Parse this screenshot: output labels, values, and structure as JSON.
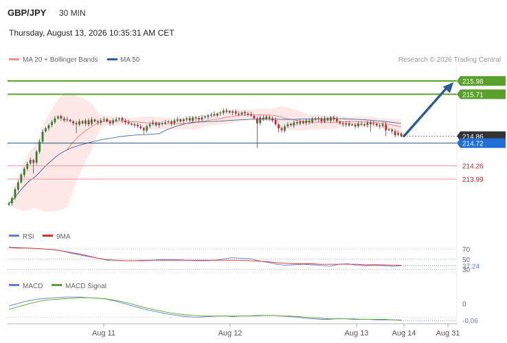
{
  "header": {
    "symbol": "GBP/JPY",
    "timeframe": "30 MIN",
    "datetime": "Thursday, August 13, 2026 10:35:31 AM CET"
  },
  "legend": {
    "ma20": "MA 20 + Bollinger Bands",
    "ma50": "MA 50",
    "credit": "Research © 2026 Trading Central"
  },
  "colors": {
    "up_candle": "#2e7d32",
    "down_candle": "#c62828",
    "ma20": "#e57373",
    "ma50": "#2f5a8f",
    "bollinger_fill": "#fde3e3",
    "resistance": "#5aa02c",
    "support": "#f4a6a6",
    "current_price_line": "#1e4f7a",
    "last_price_badge": "#333333",
    "pivot_badge": "#1f6fd6",
    "forecast_arrow": "#2f5a8f",
    "rsi": "#5b7fd6",
    "rsi_ma": "#d32f2f",
    "macd": "#5b7fd6",
    "macd_signal": "#5aa02c"
  },
  "chart_data": [
    {
      "type": "candlestick",
      "title": "",
      "x": [
        "Aug 11",
        "Aug 12",
        "Aug 13",
        "Aug 14",
        "Aug 31"
      ],
      "ylim": [
        213.1,
        216.3
      ],
      "levels": [
        {
          "value": 215.98,
          "label": "215.98",
          "kind": "resistance"
        },
        {
          "value": 215.71,
          "label": "215.71",
          "kind": "resistance"
        },
        {
          "value": 214.86,
          "label": "214.86",
          "kind": "last"
        },
        {
          "value": 214.72,
          "label": "214.72",
          "kind": "pivot"
        },
        {
          "value": 214.26,
          "label": "214.26",
          "kind": "support"
        },
        {
          "value": 213.99,
          "label": "213.99",
          "kind": "support"
        }
      ],
      "forecast": {
        "from": 214.86,
        "to": 215.98
      },
      "close_path": [
        213.5,
        213.6,
        213.78,
        213.92,
        214.08,
        214.2,
        214.3,
        214.38,
        214.32,
        214.55,
        214.75,
        214.95,
        215.02,
        215.08,
        215.15,
        215.22,
        215.26,
        215.22,
        215.18,
        215.2,
        215.16,
        215.12,
        215.1,
        215.16,
        215.12,
        215.18,
        215.1,
        215.2,
        215.16,
        215.14,
        215.18,
        215.2,
        215.16,
        215.12,
        215.18,
        215.2,
        215.22,
        215.18,
        215.14,
        215.12,
        215.1,
        215.08,
        215.06,
        215.02,
        214.98,
        215.06,
        215.1,
        215.14,
        215.08,
        215.12,
        215.12,
        215.14,
        215.16,
        215.12,
        215.18,
        215.2,
        215.16,
        215.2,
        215.22,
        215.18,
        215.24,
        215.22,
        215.2,
        215.24,
        215.26,
        215.28,
        215.3,
        215.28,
        215.32,
        215.34,
        215.38,
        215.36,
        215.34,
        215.36,
        215.32,
        215.3,
        215.34,
        215.32,
        215.3,
        215.28,
        215.22,
        215.12,
        215.24,
        215.2,
        215.26,
        215.22,
        215.18,
        215.1,
        215.02,
        214.98,
        215.06,
        215.1,
        215.08,
        215.14,
        215.12,
        215.16,
        215.12,
        215.18,
        215.14,
        215.2,
        215.22,
        215.2,
        215.16,
        215.22,
        215.18,
        215.24,
        215.2,
        215.16,
        215.12,
        215.1,
        215.12,
        215.08,
        215.1,
        215.06,
        215.12,
        215.1,
        215.08,
        215.14,
        215.1,
        215.12,
        215.08,
        215.06,
        215.1,
        214.98,
        215.0,
        214.96,
        214.88,
        214.92,
        214.86
      ],
      "events": [
        {
          "index": 8,
          "wick_low": 214.1
        },
        {
          "index": 22,
          "wick_low": 214.92
        },
        {
          "index": 44,
          "wick_low": 214.9
        },
        {
          "index": 81,
          "wick_low": 214.62
        },
        {
          "index": 88,
          "wick_low": 214.94
        },
        {
          "index": 118,
          "wick_low": 214.95
        },
        {
          "index": 123,
          "wick_low": 214.86
        }
      ],
      "series": [
        {
          "name": "MA 20 + Bollinger Bands",
          "label": "ma20"
        },
        {
          "name": "MA 50",
          "label": "ma50"
        }
      ]
    },
    {
      "type": "line",
      "panel": "RSI",
      "ylim": [
        20,
        85
      ],
      "levels": [
        70,
        50,
        30
      ],
      "value_label": "37.24",
      "value": 37.24,
      "series": [
        {
          "name": "RSI",
          "values": [
            74,
            73,
            72,
            71,
            70,
            69,
            66,
            62,
            58,
            55,
            52,
            48,
            48,
            47,
            47,
            48,
            48,
            49,
            49,
            49,
            48,
            47,
            47,
            48,
            50,
            53,
            52,
            51,
            47,
            44,
            40,
            38,
            39,
            40,
            39,
            38,
            36,
            40,
            41,
            38,
            37,
            38,
            37,
            36,
            37.24
          ]
        },
        {
          "name": "9MA",
          "values": [
            73,
            72,
            72,
            71,
            70,
            69,
            66,
            63,
            60,
            56,
            52,
            49,
            48,
            47,
            47,
            47,
            48,
            48,
            48,
            48,
            48,
            48,
            48,
            48,
            48,
            48,
            48,
            47,
            46,
            45,
            43,
            42,
            41,
            41,
            41,
            40,
            40,
            40,
            40,
            40,
            39,
            39,
            39,
            38,
            38
          ]
        }
      ]
    },
    {
      "type": "line",
      "panel": "MACD",
      "ylim": [
        -0.12,
        0.46
      ],
      "levels": [
        0
      ],
      "value_label": "-0.06",
      "value": -0.06,
      "tick_labels": [
        "0"
      ],
      "series": [
        {
          "name": "MACD",
          "values": [
            0.2,
            0.24,
            0.28,
            0.31,
            0.33,
            0.34,
            0.35,
            0.36,
            0.36,
            0.36,
            0.35,
            0.34,
            0.33,
            0.3,
            0.26,
            0.22,
            0.18,
            0.14,
            0.11,
            0.08,
            0.05,
            0.03,
            0.01,
            -0.0,
            0.0,
            0.01,
            0.02,
            0.02,
            0.01,
            0.02,
            0.02,
            0.03,
            0.03,
            0.03,
            0.02,
            0.01,
            0.0,
            -0.02,
            -0.03,
            -0.04,
            -0.04,
            -0.03,
            -0.03,
            -0.04,
            -0.04,
            -0.04,
            -0.05,
            -0.05,
            -0.05,
            -0.06
          ]
        },
        {
          "name": "MACD Signal",
          "values": [
            0.14,
            0.18,
            0.22,
            0.26,
            0.29,
            0.31,
            0.32,
            0.33,
            0.34,
            0.35,
            0.35,
            0.34,
            0.33,
            0.31,
            0.28,
            0.25,
            0.21,
            0.17,
            0.14,
            0.11,
            0.08,
            0.06,
            0.04,
            0.03,
            0.02,
            0.02,
            0.02,
            0.02,
            0.02,
            0.02,
            0.02,
            0.02,
            0.03,
            0.03,
            0.02,
            0.02,
            0.01,
            0.0,
            -0.01,
            -0.02,
            -0.03,
            -0.03,
            -0.03,
            -0.03,
            -0.04,
            -0.04,
            -0.04,
            -0.04,
            -0.05,
            -0.05
          ]
        }
      ]
    }
  ],
  "rsi_legend": {
    "rsi": "RSI",
    "ma": "9MA"
  },
  "macd_legend": {
    "macd": "MACD",
    "signal": "MACD Signal"
  },
  "x_axis": {
    "labels": [
      "Aug 11",
      "Aug 12",
      "Aug 13",
      "Aug 14",
      "Aug 31"
    ]
  }
}
